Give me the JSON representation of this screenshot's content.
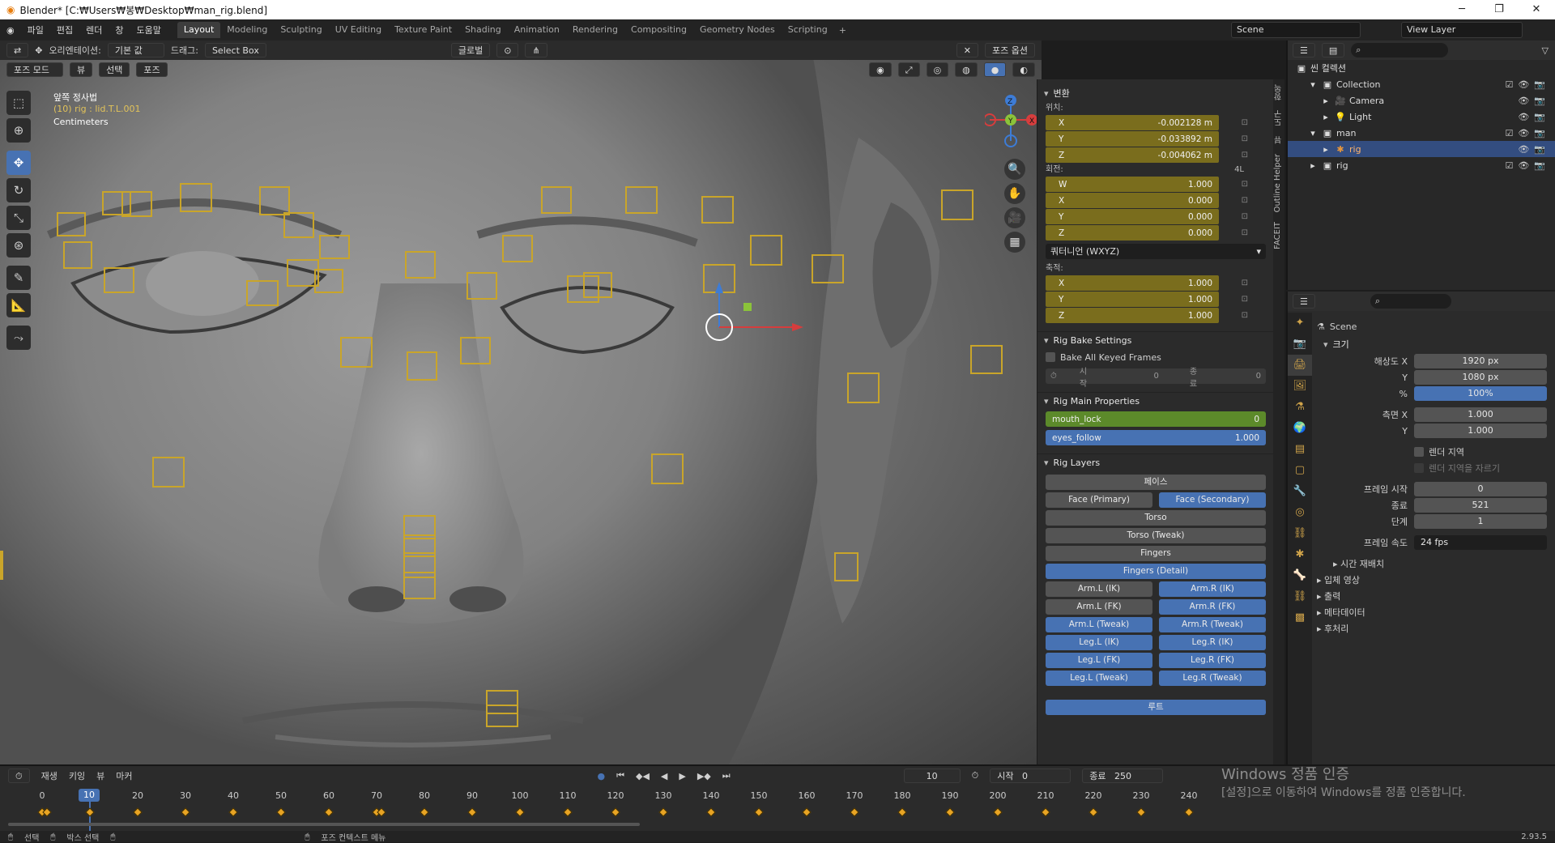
{
  "window": {
    "title": "Blender* [C:₩Users₩봉₩Desktop₩man_rig.blend]",
    "min": "─",
    "max": "❐",
    "close": "✕"
  },
  "menu": [
    "파일",
    "편집",
    "렌더",
    "창",
    "도움말"
  ],
  "workspaces": [
    "Layout",
    "Modeling",
    "Sculpting",
    "UV Editing",
    "Texture Paint",
    "Shading",
    "Animation",
    "Rendering",
    "Compositing",
    "Geometry Nodes",
    "Scripting"
  ],
  "active_workspace": "Layout",
  "scene": "Scene",
  "view_layer": "View Layer",
  "viewport": {
    "orientation_label": "오리엔테이션:",
    "orientation": "기본 값",
    "drag_label": "드래그:",
    "drag": "Select Box",
    "transform_space": "글로벌",
    "mode": "포즈 모드",
    "view": "뷰",
    "select": "선택",
    "pose": "포즈",
    "pose_options": "포즈 옵션",
    "overlay_view": "앞쪽 정사법",
    "overlay_obj": "(10) rig : lid.T.L.001",
    "overlay_units": "Centimeters"
  },
  "npanel": {
    "transform": "변환",
    "location": "위치:",
    "loc": [
      [
        "X",
        "-0.002128 m"
      ],
      [
        "Y",
        "-0.033892 m"
      ],
      [
        "Z",
        "-0.004062 m"
      ]
    ],
    "rotation": "회전:",
    "rot_mode_short": "4L",
    "rot": [
      [
        "W",
        "1.000"
      ],
      [
        "X",
        "0.000"
      ],
      [
        "Y",
        "0.000"
      ],
      [
        "Z",
        "0.000"
      ]
    ],
    "rot_mode": "쿼터니언 (WXYZ)",
    "scale": "축적:",
    "scl": [
      [
        "X",
        "1.000"
      ],
      [
        "Y",
        "1.000"
      ],
      [
        "Z",
        "1.000"
      ]
    ],
    "bake": "Rig Bake Settings",
    "bake_all": "Bake All Keyed Frames",
    "bake_start": "시작",
    "bake_start_v": "0",
    "bake_end": "종료",
    "bake_end_v": "0",
    "main": "Rig Main Properties",
    "mouth_lock": "mouth_lock",
    "mouth_lock_v": "0",
    "eyes_follow": "eyes_follow",
    "eyes_follow_v": "1.000",
    "layers": "Rig Layers",
    "face": "페이스",
    "face_primary": "Face (Primary)",
    "face_secondary": "Face (Secondary)",
    "torso": "Torso",
    "torso_tweak": "Torso (Tweak)",
    "fingers": "Fingers",
    "fingers_detail": "Fingers (Detail)",
    "armL_ik": "Arm.L (IK)",
    "armR_ik": "Arm.R (IK)",
    "armL_fk": "Arm.L (FK)",
    "armR_fk": "Arm.R (FK)",
    "armL_tw": "Arm.L (Tweak)",
    "armR_tw": "Arm.R (Tweak)",
    "legL_ik": "Leg.L (IK)",
    "legR_ik": "Leg.R (IK)",
    "legL_fk": "Leg.L (FK)",
    "legR_fk": "Leg.R (FK)",
    "legL_tw": "Leg.L (Tweak)",
    "legR_tw": "Leg.R (Tweak)",
    "root": "루트"
  },
  "sidetabs": [
    "항목",
    "도구",
    "뷰",
    "Outline Helper",
    "FACEIT"
  ],
  "outliner": {
    "scene_collection": "씬 컬렉션",
    "collection": "Collection",
    "camera": "Camera",
    "light": "Light",
    "man": "man",
    "rig_child": "rig",
    "rig": "rig"
  },
  "props": {
    "scene": "Scene",
    "format": "크기",
    "res_x_l": "해상도 X",
    "res_x": "1920 px",
    "res_y_l": "Y",
    "res_y": "1080 px",
    "pct_l": "%",
    "pct": "100%",
    "asp_x_l": "측면 X",
    "asp_x": "1.000",
    "asp_y_l": "Y",
    "asp_y": "1.000",
    "render_region": "렌더 지역",
    "crop": "렌더 지역을 자르기",
    "fs_l": "프레임 시작",
    "fs": "0",
    "fe_l": "종료",
    "fe": "521",
    "step_l": "단계",
    "step": "1",
    "rate_l": "프레임 속도",
    "rate": "24 fps",
    "time_remap": "시간 재배치",
    "stereo": "입체 영상",
    "output": "출력",
    "metadata": "메타데이터",
    "post": "후처리"
  },
  "timeline": {
    "playback": "재생",
    "keying": "키잉",
    "view": "뷰",
    "marker": "마커",
    "current": "10",
    "start_l": "시작",
    "start": "0",
    "end_l": "종료",
    "end": "250",
    "ticks": [
      "0",
      "10",
      "20",
      "30",
      "40",
      "50",
      "60",
      "70",
      "80",
      "90",
      "100",
      "110",
      "120",
      "130",
      "140",
      "150",
      "160",
      "170",
      "180",
      "190",
      "200",
      "210",
      "220",
      "230",
      "240"
    ]
  },
  "status": {
    "select": "선택",
    "box": "박스 선택",
    "ctx": "포즈 컨텍스트 메뉴",
    "version": "2.93.5"
  },
  "watermark": {
    "t1": "Windows 정품 인증",
    "t2": "[설정]으로 이동하여 Windows를 정품 인증합니다."
  }
}
